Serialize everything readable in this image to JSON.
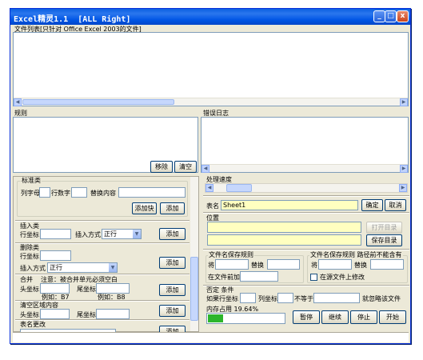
{
  "window": {
    "title": "Excel精灵1.1  [ALL Right]",
    "controls": [
      "_",
      "□",
      "x"
    ]
  },
  "files": {
    "label": "文件列表[只针对 Office Excel 2003的文件]"
  },
  "rules": {
    "label": "规则",
    "remove_btn": "移除",
    "clear_btn": "清空"
  },
  "errlog": {
    "label": "错误日志"
  },
  "std": {
    "title": "标准类",
    "col_label": "列字母",
    "row_label": "行数字",
    "replace_label": "替换内容",
    "add_fast_btn": "添加快",
    "add_btn": "添加"
  },
  "insert": {
    "title": "插入类",
    "row_label": "行坐标",
    "mode_label": "插入方式",
    "mode_value": "正行",
    "add_btn": "添加"
  },
  "delete": {
    "title": "删除类",
    "row_label": "行坐标",
    "mode_label": "插入方式",
    "mode_value": "正行",
    "add_btn": "添加"
  },
  "merge": {
    "title": "合并",
    "note": "注意：被合并单元必须空白",
    "start_label": "头坐标",
    "end_label": "尾坐标",
    "ex1": "例如：B7",
    "ex2": "例如：B8",
    "add_btn": "添加"
  },
  "clear": {
    "title": "清空区域内容",
    "start_label": "头坐标",
    "end_label": "尾坐标",
    "add_btn": "添加"
  },
  "rename": {
    "title": "表名更改",
    "add_btn": "添加"
  },
  "progress": {
    "title": "处理速度",
    "value": 0.08
  },
  "sheet": {
    "label": "表名",
    "value": "Sheet1",
    "ok_btn": "确定",
    "cancel_btn": "取消"
  },
  "position": {
    "title": "位置",
    "open_btn": "打开目录",
    "save_btn": "保存目录"
  },
  "fname": {
    "title": "文件名保存规则",
    "before_label": "将",
    "replace_label": "替换",
    "prefix_label": "在文件前加",
    "title2": "文件名保存规则 路径前不能含有",
    "before_label2": "将",
    "replace_label2": "替换",
    "src_check": "在源文件上修改"
  },
  "deny": {
    "title": "否定 条件",
    "if_label": "如果行坐标",
    "col_label": "列坐标",
    "neq_label": "不等于",
    "skip_label": "就忽略该文件"
  },
  "memory": {
    "title": "内存占用 19.64%",
    "value": 0.1964,
    "pause_btn": "暂停",
    "resume_btn": "继续",
    "stop_btn": "停止",
    "start_btn": "开始"
  },
  "colors": {
    "title_blue": "#0055e5",
    "accent_yellow": "#ffffc0",
    "progress_green": "#2bb52b",
    "bg": "#ece9d8"
  }
}
